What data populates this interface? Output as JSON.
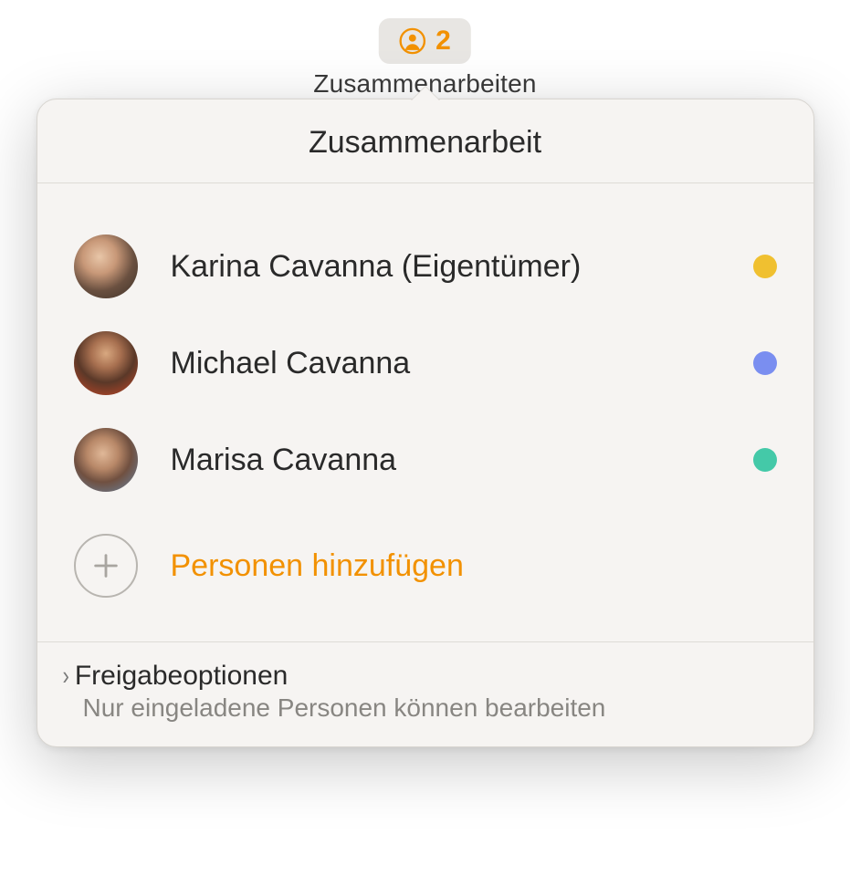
{
  "toolbar": {
    "button_count": "2",
    "label": "Zusammenarbeiten",
    "accent_color": "#f29100"
  },
  "popover": {
    "title": "Zusammenarbeit",
    "participants": [
      {
        "name": "Karina Cavanna (Eigentümer)",
        "dot_color": "#f0c030"
      },
      {
        "name": "Michael Cavanna",
        "dot_color": "#7a8ef0"
      },
      {
        "name": "Marisa Cavanna",
        "dot_color": "#44c9a8"
      }
    ],
    "add_label": "Personen hinzufügen",
    "share": {
      "title": "Freigabeoptionen",
      "subtitle": "Nur eingeladene Personen können bearbeiten"
    }
  }
}
